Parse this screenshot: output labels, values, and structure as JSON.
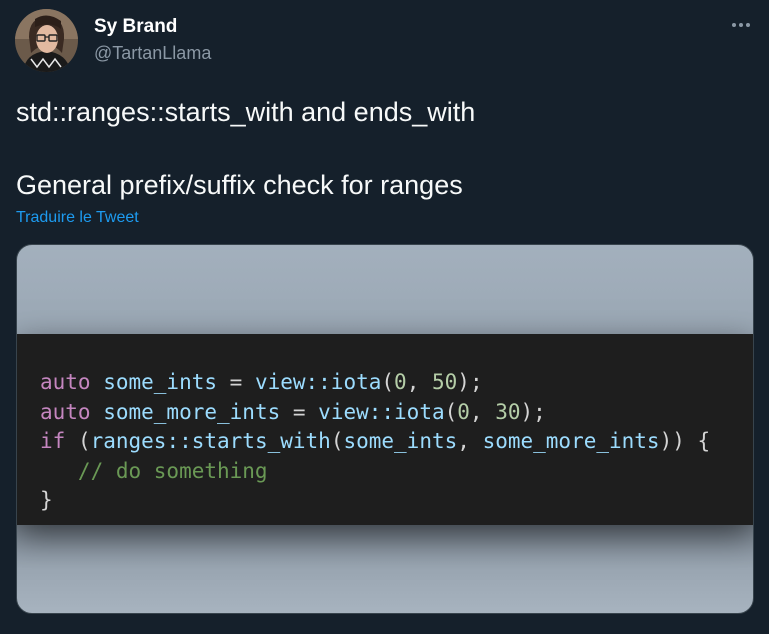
{
  "author": {
    "name": "Sy Brand",
    "handle": "@TartanLlama"
  },
  "tweet": {
    "line1": "std::ranges::starts_with and ends_with",
    "line2": "General prefix/suffix check for ranges",
    "translate_link": "Traduire le Tweet"
  },
  "code_image": {
    "lines": [
      {
        "kw": "auto",
        "rest": " some_ints = view::iota(0, 50);"
      },
      {
        "kw": "auto",
        "rest": " some_more_ints = view::iota(0, 30);"
      },
      {
        "kw": "if",
        "rest": " (ranges::starts_with(some_ints, some_more_ints)) {"
      },
      {
        "comment": "   // do something"
      },
      {
        "plain": "}"
      }
    ],
    "tokens": {
      "l1_kw": "auto",
      "l1_id": " some_ints",
      "l1_eq": " = ",
      "l1_fn": "view::iota",
      "l1_open": "(",
      "l1_n1": "0",
      "l1_comma": ", ",
      "l1_n2": "50",
      "l1_close": ");",
      "l2_kw": "auto",
      "l2_id": " some_more_ints",
      "l2_eq": " = ",
      "l2_fn": "view::iota",
      "l2_open": "(",
      "l2_n1": "0",
      "l2_comma": ", ",
      "l2_n2": "30",
      "l2_close": ");",
      "l3_kw": "if",
      "l3_open": " (",
      "l3_fn": "ranges::starts_with",
      "l3_paren": "(",
      "l3_a": "some_ints",
      "l3_comma": ", ",
      "l3_b": "some_more_ints",
      "l3_close": ")) {",
      "l4_comment": "   // do something",
      "l5_brace": "}"
    }
  },
  "icons": {
    "more": "more-horizontal-icon"
  },
  "colors": {
    "background": "#15202b",
    "link": "#1d9bf0",
    "handle": "#8b98a5",
    "code_keyword": "#c586c0",
    "code_identifier": "#9cdcfe",
    "code_number": "#b5cea8",
    "code_comment": "#6a9955"
  }
}
